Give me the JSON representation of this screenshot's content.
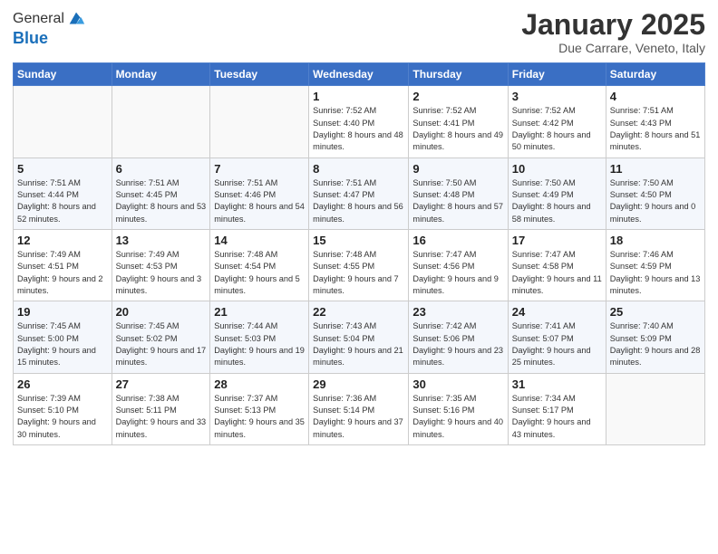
{
  "logo": {
    "general": "General",
    "blue": "Blue"
  },
  "header": {
    "month": "January 2025",
    "location": "Due Carrare, Veneto, Italy"
  },
  "weekdays": [
    "Sunday",
    "Monday",
    "Tuesday",
    "Wednesday",
    "Thursday",
    "Friday",
    "Saturday"
  ],
  "weeks": [
    [
      {
        "day": "",
        "sunrise": "",
        "sunset": "",
        "daylight": ""
      },
      {
        "day": "",
        "sunrise": "",
        "sunset": "",
        "daylight": ""
      },
      {
        "day": "",
        "sunrise": "",
        "sunset": "",
        "daylight": ""
      },
      {
        "day": "1",
        "sunrise": "Sunrise: 7:52 AM",
        "sunset": "Sunset: 4:40 PM",
        "daylight": "Daylight: 8 hours and 48 minutes."
      },
      {
        "day": "2",
        "sunrise": "Sunrise: 7:52 AM",
        "sunset": "Sunset: 4:41 PM",
        "daylight": "Daylight: 8 hours and 49 minutes."
      },
      {
        "day": "3",
        "sunrise": "Sunrise: 7:52 AM",
        "sunset": "Sunset: 4:42 PM",
        "daylight": "Daylight: 8 hours and 50 minutes."
      },
      {
        "day": "4",
        "sunrise": "Sunrise: 7:51 AM",
        "sunset": "Sunset: 4:43 PM",
        "daylight": "Daylight: 8 hours and 51 minutes."
      }
    ],
    [
      {
        "day": "5",
        "sunrise": "Sunrise: 7:51 AM",
        "sunset": "Sunset: 4:44 PM",
        "daylight": "Daylight: 8 hours and 52 minutes."
      },
      {
        "day": "6",
        "sunrise": "Sunrise: 7:51 AM",
        "sunset": "Sunset: 4:45 PM",
        "daylight": "Daylight: 8 hours and 53 minutes."
      },
      {
        "day": "7",
        "sunrise": "Sunrise: 7:51 AM",
        "sunset": "Sunset: 4:46 PM",
        "daylight": "Daylight: 8 hours and 54 minutes."
      },
      {
        "day": "8",
        "sunrise": "Sunrise: 7:51 AM",
        "sunset": "Sunset: 4:47 PM",
        "daylight": "Daylight: 8 hours and 56 minutes."
      },
      {
        "day": "9",
        "sunrise": "Sunrise: 7:50 AM",
        "sunset": "Sunset: 4:48 PM",
        "daylight": "Daylight: 8 hours and 57 minutes."
      },
      {
        "day": "10",
        "sunrise": "Sunrise: 7:50 AM",
        "sunset": "Sunset: 4:49 PM",
        "daylight": "Daylight: 8 hours and 58 minutes."
      },
      {
        "day": "11",
        "sunrise": "Sunrise: 7:50 AM",
        "sunset": "Sunset: 4:50 PM",
        "daylight": "Daylight: 9 hours and 0 minutes."
      }
    ],
    [
      {
        "day": "12",
        "sunrise": "Sunrise: 7:49 AM",
        "sunset": "Sunset: 4:51 PM",
        "daylight": "Daylight: 9 hours and 2 minutes."
      },
      {
        "day": "13",
        "sunrise": "Sunrise: 7:49 AM",
        "sunset": "Sunset: 4:53 PM",
        "daylight": "Daylight: 9 hours and 3 minutes."
      },
      {
        "day": "14",
        "sunrise": "Sunrise: 7:48 AM",
        "sunset": "Sunset: 4:54 PM",
        "daylight": "Daylight: 9 hours and 5 minutes."
      },
      {
        "day": "15",
        "sunrise": "Sunrise: 7:48 AM",
        "sunset": "Sunset: 4:55 PM",
        "daylight": "Daylight: 9 hours and 7 minutes."
      },
      {
        "day": "16",
        "sunrise": "Sunrise: 7:47 AM",
        "sunset": "Sunset: 4:56 PM",
        "daylight": "Daylight: 9 hours and 9 minutes."
      },
      {
        "day": "17",
        "sunrise": "Sunrise: 7:47 AM",
        "sunset": "Sunset: 4:58 PM",
        "daylight": "Daylight: 9 hours and 11 minutes."
      },
      {
        "day": "18",
        "sunrise": "Sunrise: 7:46 AM",
        "sunset": "Sunset: 4:59 PM",
        "daylight": "Daylight: 9 hours and 13 minutes."
      }
    ],
    [
      {
        "day": "19",
        "sunrise": "Sunrise: 7:45 AM",
        "sunset": "Sunset: 5:00 PM",
        "daylight": "Daylight: 9 hours and 15 minutes."
      },
      {
        "day": "20",
        "sunrise": "Sunrise: 7:45 AM",
        "sunset": "Sunset: 5:02 PM",
        "daylight": "Daylight: 9 hours and 17 minutes."
      },
      {
        "day": "21",
        "sunrise": "Sunrise: 7:44 AM",
        "sunset": "Sunset: 5:03 PM",
        "daylight": "Daylight: 9 hours and 19 minutes."
      },
      {
        "day": "22",
        "sunrise": "Sunrise: 7:43 AM",
        "sunset": "Sunset: 5:04 PM",
        "daylight": "Daylight: 9 hours and 21 minutes."
      },
      {
        "day": "23",
        "sunrise": "Sunrise: 7:42 AM",
        "sunset": "Sunset: 5:06 PM",
        "daylight": "Daylight: 9 hours and 23 minutes."
      },
      {
        "day": "24",
        "sunrise": "Sunrise: 7:41 AM",
        "sunset": "Sunset: 5:07 PM",
        "daylight": "Daylight: 9 hours and 25 minutes."
      },
      {
        "day": "25",
        "sunrise": "Sunrise: 7:40 AM",
        "sunset": "Sunset: 5:09 PM",
        "daylight": "Daylight: 9 hours and 28 minutes."
      }
    ],
    [
      {
        "day": "26",
        "sunrise": "Sunrise: 7:39 AM",
        "sunset": "Sunset: 5:10 PM",
        "daylight": "Daylight: 9 hours and 30 minutes."
      },
      {
        "day": "27",
        "sunrise": "Sunrise: 7:38 AM",
        "sunset": "Sunset: 5:11 PM",
        "daylight": "Daylight: 9 hours and 33 minutes."
      },
      {
        "day": "28",
        "sunrise": "Sunrise: 7:37 AM",
        "sunset": "Sunset: 5:13 PM",
        "daylight": "Daylight: 9 hours and 35 minutes."
      },
      {
        "day": "29",
        "sunrise": "Sunrise: 7:36 AM",
        "sunset": "Sunset: 5:14 PM",
        "daylight": "Daylight: 9 hours and 37 minutes."
      },
      {
        "day": "30",
        "sunrise": "Sunrise: 7:35 AM",
        "sunset": "Sunset: 5:16 PM",
        "daylight": "Daylight: 9 hours and 40 minutes."
      },
      {
        "day": "31",
        "sunrise": "Sunrise: 7:34 AM",
        "sunset": "Sunset: 5:17 PM",
        "daylight": "Daylight: 9 hours and 43 minutes."
      },
      {
        "day": "",
        "sunrise": "",
        "sunset": "",
        "daylight": ""
      }
    ]
  ]
}
